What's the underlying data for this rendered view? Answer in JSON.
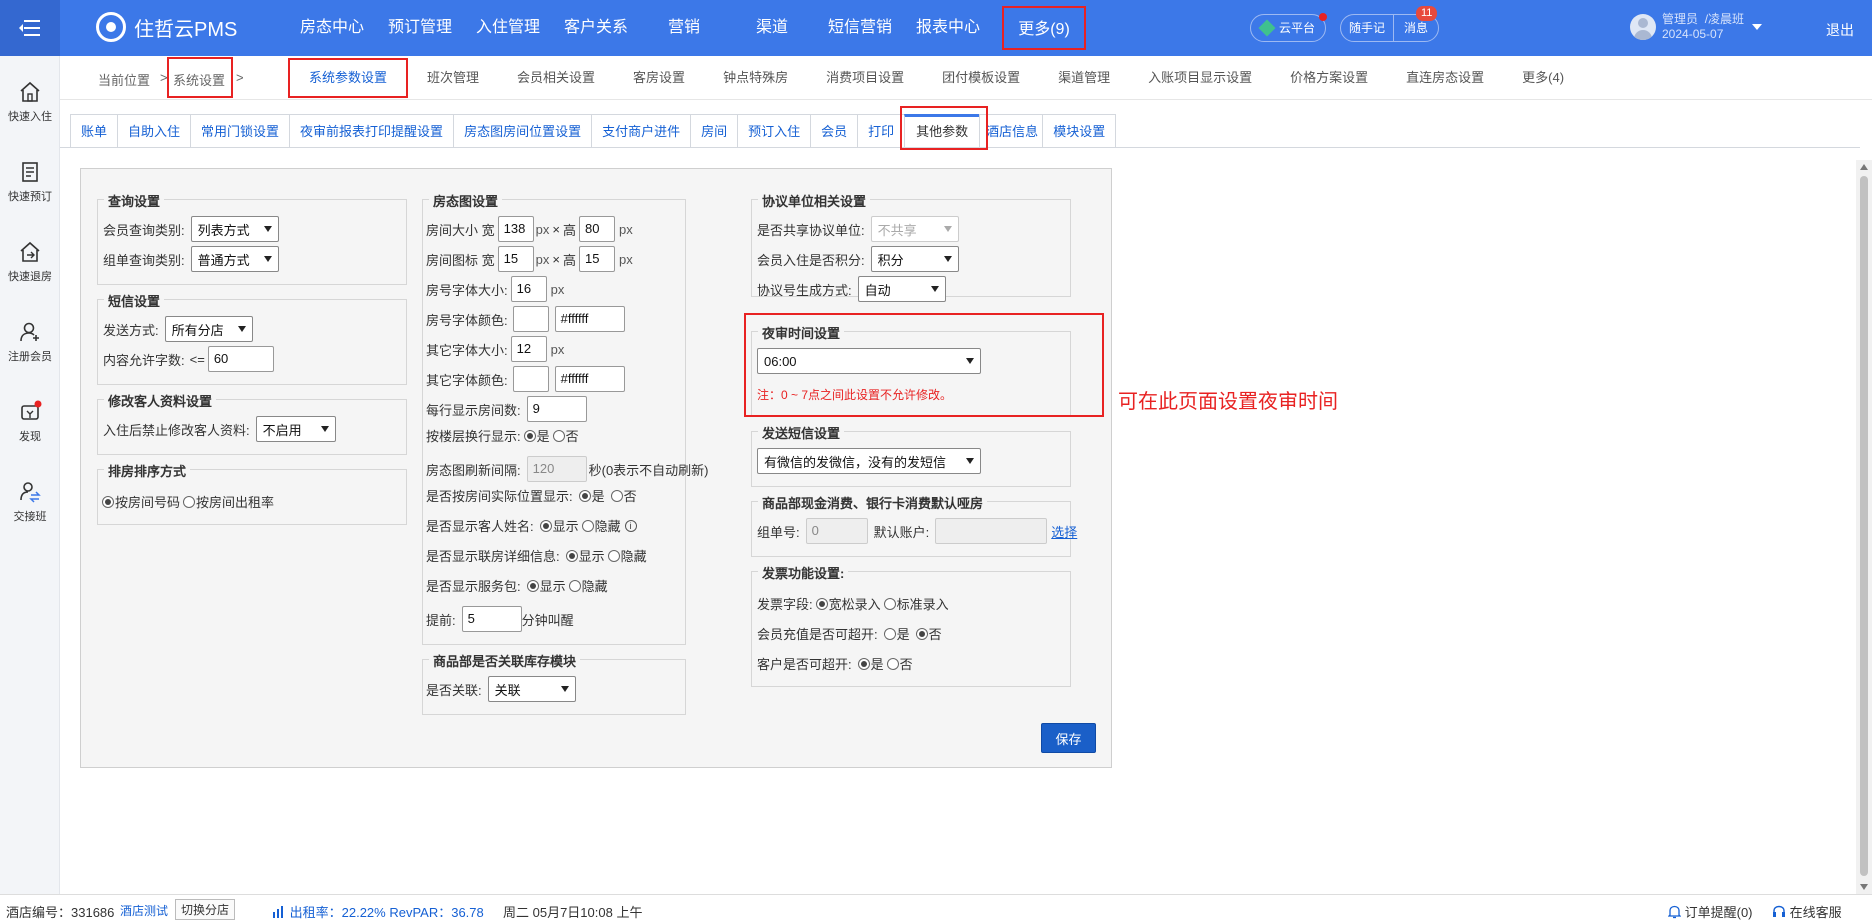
{
  "app": {
    "logo_text": "住哲云PMS",
    "nav": [
      "房态中心",
      "预订管理",
      "入住管理",
      "客户关系",
      "营销",
      "渠道",
      "短信营销",
      "报表中心"
    ],
    "nav_more": "更多(9)",
    "cloud": "云平台",
    "notes": "随手记",
    "message": "消息",
    "message_count": "11",
    "user_role": "管理员",
    "user_shift": "/凌晨班",
    "user_date": "2024-05-07",
    "logout": "退出"
  },
  "sidebar": [
    "快速入住",
    "快速预订",
    "快速退房",
    "注册会员",
    "发现",
    "交接班"
  ],
  "breadcrumb": {
    "current": "当前位置",
    "sep": ">",
    "section": "系统设置",
    "sep2": ">"
  },
  "subnav": [
    "系统参数设置",
    "班次管理",
    "会员相关设置",
    "客房设置",
    "钟点特殊房",
    "消费项目设置",
    "团付模板设置",
    "渠道管理",
    "入账项目显示设置",
    "价格方案设置",
    "直连房态设置",
    "更多(4)"
  ],
  "tabs": [
    "账单",
    "自助入住",
    "常用门锁设置",
    "夜审前报表打印提醒设置",
    "房态图房间位置设置",
    "支付商户进件",
    "房间",
    "预订入住",
    "会员",
    "打印",
    "其他参数",
    "酒店信息",
    "模块设置"
  ],
  "query": {
    "title": "查询设置",
    "member_label": "会员查询类别:",
    "member_value": "列表方式",
    "group_label": "组单查询类别:",
    "group_value": "普通方式"
  },
  "sms": {
    "title": "短信设置",
    "send_label": "发送方式:",
    "send_value": "所有分店",
    "len_label": "内容允许字数:",
    "len_op": "<=",
    "len_value": "60"
  },
  "guest_edit": {
    "title": "修改客人资料设置",
    "label": "入住后禁止修改客人资料:",
    "value": "不启用"
  },
  "sort": {
    "title": "排房排序方式",
    "opt1": "按房间号码",
    "opt2": "按房间出租率"
  },
  "roommap": {
    "title": "房态图设置",
    "size_label": "房间大小 宽",
    "size_w": "138",
    "px": "px",
    "times": "×",
    "high": "高",
    "size_h": "80",
    "icon_label": "房间图标 宽",
    "icon_w": "15",
    "icon_h": "15",
    "num_font_label": "房号字体大小:",
    "num_font": "16",
    "num_color_label": "房号字体颜色:",
    "num_color": "#ffffff",
    "other_font_label": "其它字体大小:",
    "other_font": "12",
    "other_color_label": "其它字体颜色:",
    "other_color": "#ffffff",
    "per_row_label": "每行显示房间数:",
    "per_row": "9",
    "floor_label": "按楼层换行显示:",
    "yes": "是",
    "no": "否",
    "refresh_label": "房态图刷新间隔:",
    "refresh": "120",
    "refresh_unit": "秒(0表示不自动刷新)",
    "pos_label": "是否按房间实际位置显示:",
    "guest_label": "是否显示客人姓名:",
    "show": "显示",
    "hide": "隐藏",
    "info_icon": "i",
    "linked_label": "是否显示联房详细信息:",
    "service_label": "是否显示服务包:",
    "remind_label": "提前:",
    "remind": "5",
    "remind_unit": "分钟叫醒"
  },
  "stock": {
    "title": "商品部是否关联库存模块",
    "label": "是否关联:",
    "value": "关联"
  },
  "agreement": {
    "title": "协议单位相关设置",
    "share_label": "是否共享协议单位:",
    "share_value": "不共享",
    "points_label": "会员入住是否积分:",
    "points_value": "积分",
    "gen_label": "协议号生成方式:",
    "gen_value": "自动"
  },
  "night_audit": {
    "title": "夜审时间设置",
    "value": "06:00",
    "note": "注：0 ~ 7点之间此设置不允许修改。"
  },
  "send_sms": {
    "title": "发送短信设置",
    "value": "有微信的发微信，没有的发短信"
  },
  "default_room": {
    "title": "商品部现金消费、银行卡消费默认哑房",
    "group_label": "组单号:",
    "group_value": "0",
    "account_label": "默认账户:",
    "select": "选择"
  },
  "invoice": {
    "title": "发票功能设置:",
    "field_label": "发票字段:",
    "opt1": "宽松录入",
    "opt2": "标准录入",
    "member_label": "会员充值是否可超开:",
    "customer_label": "客户是否可超开:",
    "yes": "是",
    "no": "否"
  },
  "save": "保存",
  "annotation": "可在此页面设置夜审时间",
  "footer": {
    "hotel_label": "酒店编号：",
    "hotel_id": "331686",
    "hotel_name": "酒店测试",
    "switch": "切换分店",
    "rate": "出租率：22.22% RevPAR：36.78",
    "datetime": "周二 05月7日10:08 上午",
    "orders": "订单提醒(0)",
    "service": "在线客服"
  }
}
